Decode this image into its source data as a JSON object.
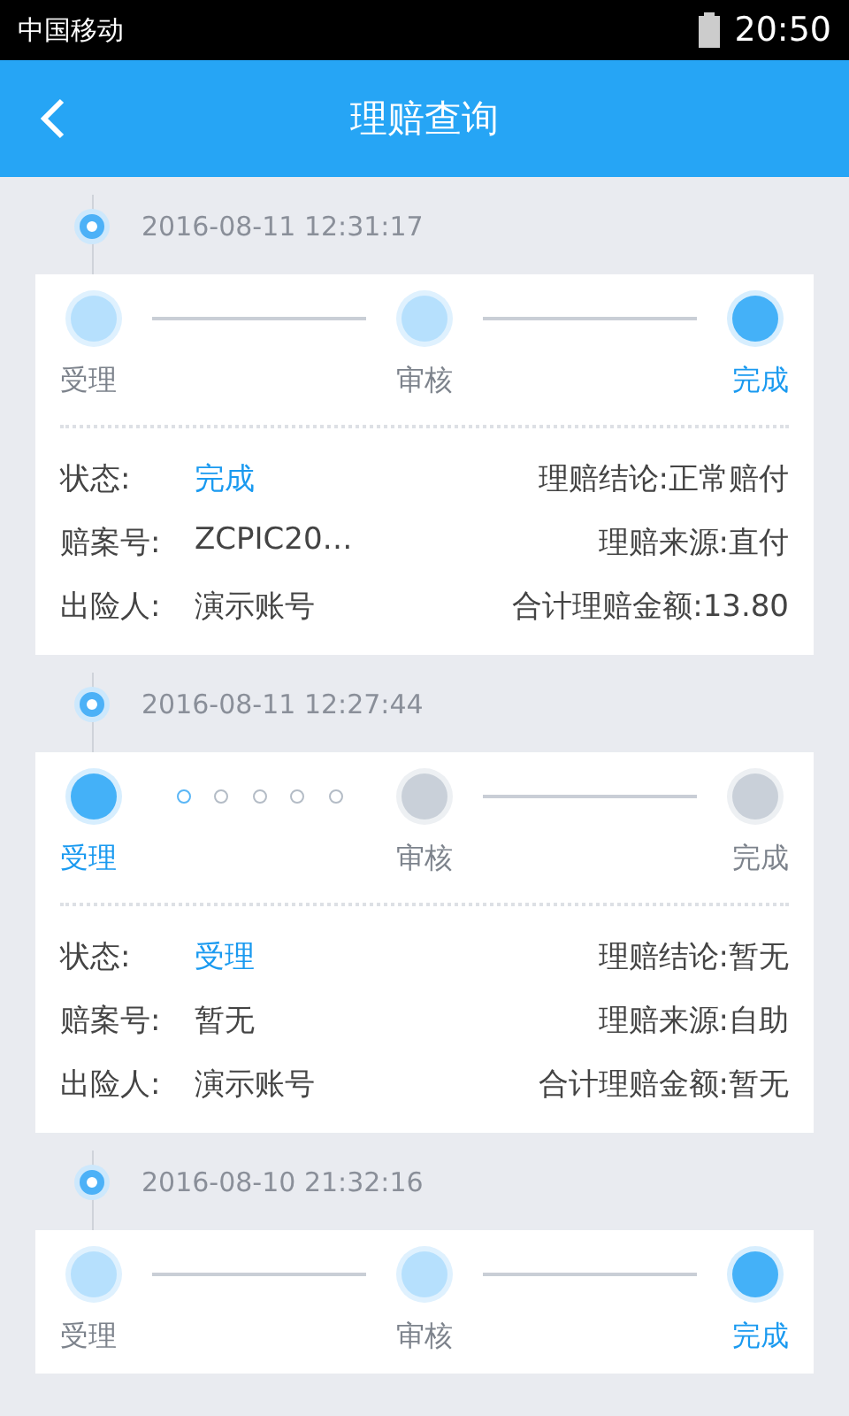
{
  "status_bar": {
    "carrier": "中国移动",
    "time": "20:50"
  },
  "header": {
    "title": "理赔查询"
  },
  "claims": [
    {
      "time": "2016-08-11 12:31:17",
      "steps": [
        {
          "label": "受理",
          "kind": "done",
          "selected": false
        },
        {
          "label": "审核",
          "kind": "done",
          "selected": false
        },
        {
          "label": "完成",
          "kind": "current",
          "selected": true
        }
      ],
      "connectors": [
        {
          "kind": "line"
        },
        {
          "kind": "line"
        }
      ],
      "details": [
        {
          "left_label": "状态:",
          "left_value": "完成",
          "left_highlight": true,
          "right_label": "理赔结论:",
          "right_value": "正常赔付"
        },
        {
          "left_label": "赔案号:",
          "left_value": "ZCPIC20…",
          "left_highlight": false,
          "right_label": "理赔来源:",
          "right_value": "直付"
        },
        {
          "left_label": "出险人:",
          "left_value": "演示账号",
          "left_highlight": false,
          "right_label": "合计理赔金额:",
          "right_value": "13.80"
        }
      ]
    },
    {
      "time": "2016-08-11 12:27:44",
      "steps": [
        {
          "label": "受理",
          "kind": "current",
          "selected": true
        },
        {
          "label": "审核",
          "kind": "pending",
          "selected": false
        },
        {
          "label": "完成",
          "kind": "pending",
          "selected": false
        }
      ],
      "connectors": [
        {
          "kind": "dots"
        },
        {
          "kind": "line"
        }
      ],
      "details": [
        {
          "left_label": "状态:",
          "left_value": "受理",
          "left_highlight": true,
          "right_label": "理赔结论:",
          "right_value": "暂无"
        },
        {
          "left_label": "赔案号:",
          "left_value": "暂无",
          "left_highlight": false,
          "right_label": "理赔来源:",
          "right_value": "自助"
        },
        {
          "left_label": "出险人:",
          "left_value": "演示账号",
          "left_highlight": false,
          "right_label": "合计理赔金额:",
          "right_value": "暂无"
        }
      ]
    },
    {
      "time": "2016-08-10 21:32:16",
      "steps": [
        {
          "label": "受理",
          "kind": "done",
          "selected": false
        },
        {
          "label": "审核",
          "kind": "done",
          "selected": false
        },
        {
          "label": "完成",
          "kind": "current",
          "selected": true
        }
      ],
      "connectors": [
        {
          "kind": "line"
        },
        {
          "kind": "line"
        }
      ]
    }
  ]
}
